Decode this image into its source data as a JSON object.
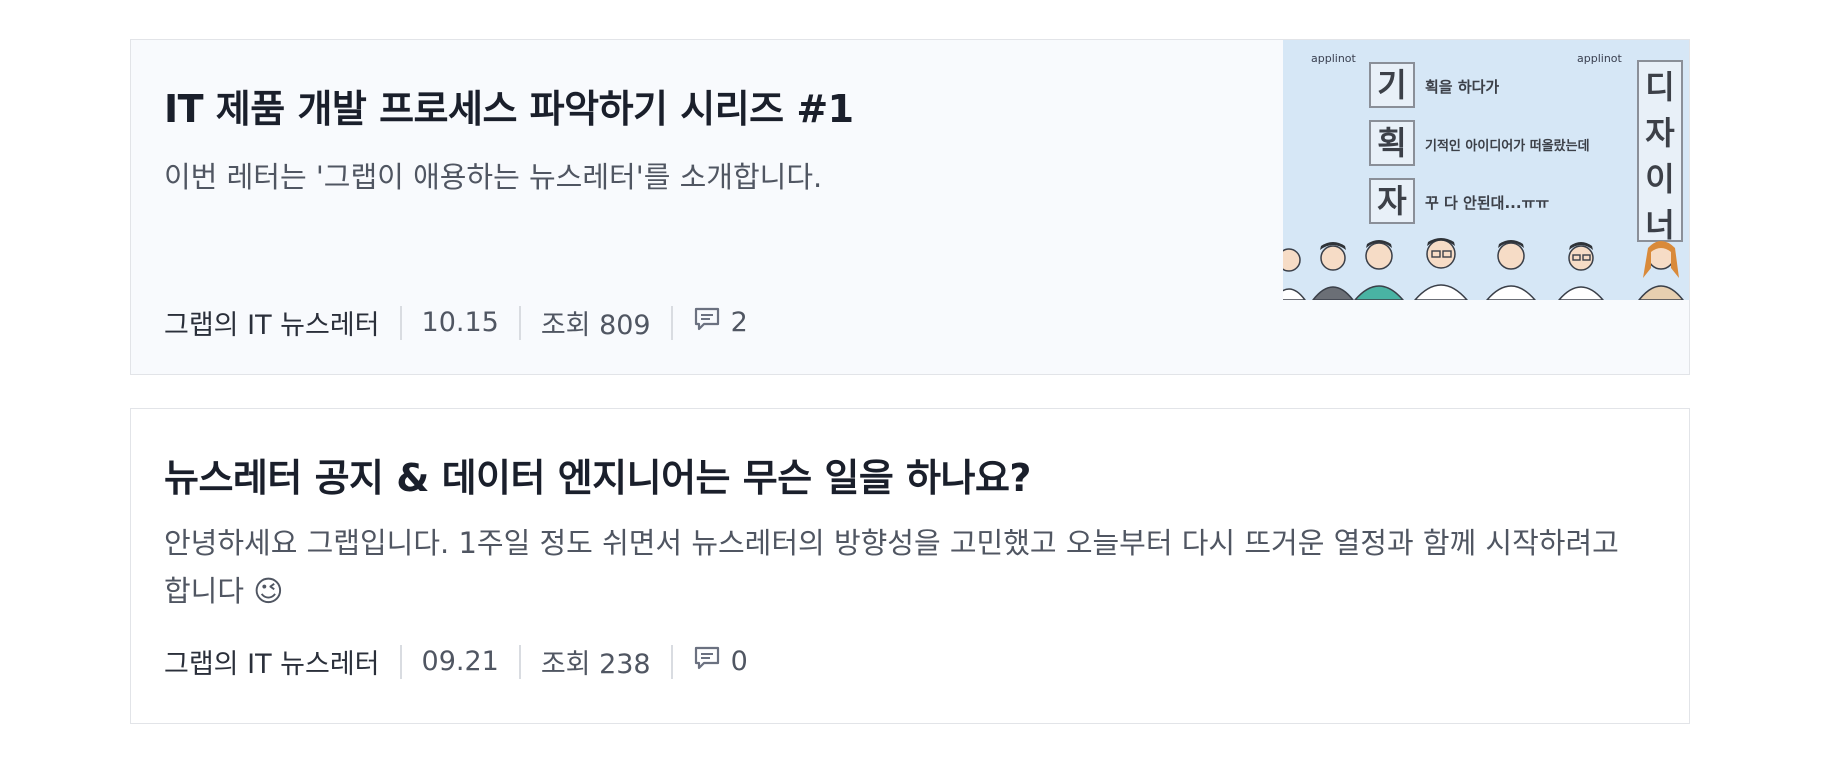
{
  "articles": [
    {
      "title": "IT 제품 개발 프로세스 파악하기 시리즈 #1",
      "excerpt": "이번 레터는 '그랩이 애용하는 뉴스레터'를 소개합니다.",
      "publisher": "그랩의 IT 뉴스레터",
      "date": "10.15",
      "views": "조회 809",
      "comments": "2",
      "thumbnail": {
        "brand_left": "applinot",
        "brand_right": "applinot",
        "left_column": [
          "기",
          "획",
          "자"
        ],
        "lines": [
          "획을 하다가",
          "기적인 아이디어가 떠올랐는데",
          "꾸 다 안된대...ㅠㅠ"
        ],
        "right_column": [
          "디",
          "자",
          "이",
          "너"
        ]
      }
    },
    {
      "title": "뉴스레터 공지 & 데이터 엔지니어는 무슨 일을 하나요?",
      "excerpt": "안녕하세요 그랩입니다. 1주일 정도 쉬면서 뉴스레터의 방향성을 고민했고 오늘부터 다시 뜨거운 열정과 함께 시작하려고 합니다 😉",
      "publisher": "그랩의 IT 뉴스레터",
      "date": "09.21",
      "views": "조회 238",
      "comments": "0"
    }
  ],
  "colors": {
    "title": "#1a1f2b",
    "body": "#505662",
    "border": "#e2e4e8",
    "highlight_bg": "#f8fafd",
    "thumb_bg": "#d6e7f6"
  },
  "icons": {
    "comment": "comment-icon"
  }
}
